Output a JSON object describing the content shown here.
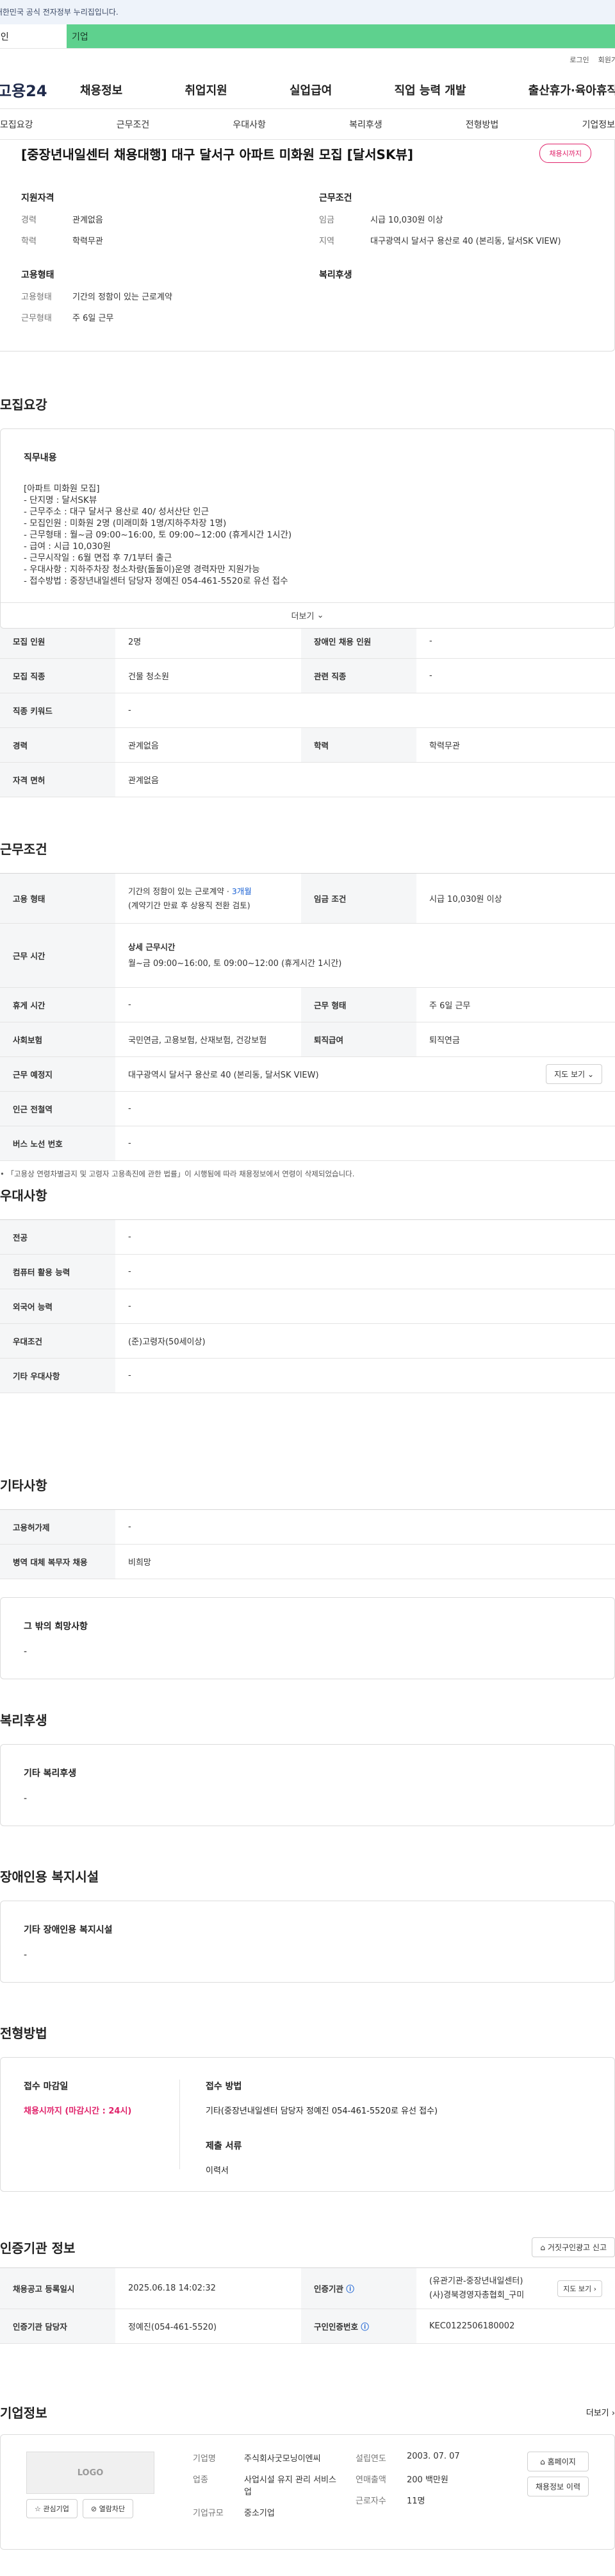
{
  "gov_notice": "이 누리집은 대한민국 공식 전자정부 누리집입니다.",
  "tabs": {
    "individual": "개인",
    "company": "기업"
  },
  "util": {
    "login": "로그인",
    "join": "회원가"
  },
  "brand": {
    "logo": "고용24"
  },
  "gnb": [
    "채용정보",
    "취업지원",
    "실업급여",
    "직업 능력 개발",
    "출산휴가·육아휴직"
  ],
  "subnav": [
    "모집요강",
    "근무조건",
    "우대사항",
    "복리후생",
    "전형방법",
    "기업정보"
  ],
  "summary": {
    "title": "[중장년내일센터 채용대행] 대구 달서구 아파트 미화원 모집 [달서SK뷰]",
    "badge": "채용시까지",
    "qual_title": "지원자격",
    "qual": [
      {
        "k": "경력",
        "v": "관계없음"
      },
      {
        "k": "학력",
        "v": "학력무관"
      }
    ],
    "cond_title": "근무조건",
    "cond": [
      {
        "k": "임금",
        "v": "시급 10,030원 이상"
      },
      {
        "k": "지역",
        "v": "대구광역시 달서구 용산로 40 (본리동, 달서SK VIEW)"
      }
    ],
    "emp_title": "고용형태",
    "emp": [
      {
        "k": "고용형태",
        "v": "기간의 정함이 있는 근로계약"
      },
      {
        "k": "근무형태",
        "v": "주 6일 근무"
      }
    ],
    "welfare_title": "복리후생"
  },
  "recruit": {
    "title": "모집요강",
    "duty_title": "직무내용",
    "duty_lines": [
      "[아파트 미화원 모집]",
      "- 단지명 : 달서SK뷰",
      "- 근무주소 : 대구 달서구 용산로 40/ 성서산단 인근",
      "- 모집인원 : 미화원 2명 (미래미화 1명/지하주차장 1명)",
      "- 근무형태 : 월~금 09:00~16:00, 토 09:00~12:00 (휴게시간 1시간)",
      "- 급여 : 시급 10,030원",
      "- 근무시작일 : 6월 면접 후 7/1부터 출근",
      "- 우대사항 : 지하주차장 청소차량(돌돌이)운영 경력자만 지원가능",
      "- 접수방법 : 중장년내일센터 담당자 정예진 054-461-5520로 유선 접수"
    ],
    "more": "더보기",
    "rows": [
      [
        "모집 인원",
        "2명",
        "장애인 채용 인원",
        "-"
      ],
      [
        "모집 직종",
        "건물 청소원",
        "관련 직종",
        "-"
      ],
      [
        "직종 키워드",
        "-"
      ],
      [
        "경력",
        "관계없음",
        "학력",
        "학력무관"
      ],
      [
        "자격 면허",
        "관계없음"
      ]
    ]
  },
  "work": {
    "title": "근무조건",
    "employment_label": "고용 형태",
    "employment_value": "기간의 정함이 있는 근로계약 ·",
    "employment_period": "3개월",
    "employment_sub": "(계약기간 만료 후 상용직 전환 검토)",
    "wage_label": "임금 조건",
    "wage_value": "시급 10,030원 이상",
    "hours_label": "근무 시간",
    "hours_head": "상세 근무시간",
    "hours_value": "월~금 09:00~16:00, 토 09:00~12:00 (휴게시간 1시간)",
    "break_label": "휴게 시간",
    "break_value": "-",
    "worktype_label": "근무 형태",
    "worktype_value": "주 6일 근무",
    "ins_label": "사회보험",
    "ins_value": "국민연금, 고용보험, 산재보험, 건강보험",
    "sev_label": "퇴직급여",
    "sev_value": "퇴직연금",
    "place_label": "근무 예정지",
    "place_value": "대구광역시 달서구 용산로 40 (본리동, 달서SK VIEW)",
    "map_btn": "지도 보기",
    "subway_label": "인근 전철역",
    "subway_value": "-",
    "bus_label": "버스 노선 번호",
    "bus_value": "-",
    "note": "「고용상 연령차별금지 및 고령자 고용촉진에 관한 법률」이 시행됨에 따라 채용정보에서 연령이 삭제되었습니다."
  },
  "pref": {
    "title": "우대사항",
    "rows": [
      [
        "전공",
        "-"
      ],
      [
        "컴퓨터 활용 능력",
        "-"
      ],
      [
        "외국어 능력",
        "-"
      ],
      [
        "우대조건",
        "(준)고령자(50세이상)"
      ],
      [
        "기타 우대사항",
        "-"
      ]
    ]
  },
  "etc": {
    "title": "기타사항",
    "rows": [
      [
        "고용허가제",
        "-"
      ],
      [
        "병역 대체 복무자 채용",
        "비희망"
      ]
    ],
    "other_title": "그 밖의 희망사항",
    "other_value": "-"
  },
  "welfare": {
    "title": "복리후생",
    "box_title": "기타 복리후생",
    "box_value": "-"
  },
  "disab": {
    "title": "장애인용 복지시설",
    "box_title": "기타 장애인용 복지시설",
    "box_value": "-"
  },
  "screening": {
    "title": "전형방법",
    "deadline_title": "접수 마감일",
    "deadline_value": "채용시까지 (마감시간 : 24시)",
    "method_title": "접수 방법",
    "method_value": "기타(중장년내일센터 담당자 정예진 054-461-5520로 유선 접수)",
    "docs_title": "제출 서류",
    "docs_value": "이력서"
  },
  "cert": {
    "title": "인증기관 정보",
    "report_btn": "거짓구인광고 신고",
    "reg_label": "채용공고 등록일시",
    "reg_value": "2025.06.18 14:02:32",
    "org_label": "인증기관",
    "org_value1": "(유관기관-중장년내일센터)",
    "org_value2": "(사)경북경영자총협회_구미",
    "map_btn": "지도 보기",
    "mgr_label": "인증기관 담당자",
    "mgr_value": "정예진(054-461-5520)",
    "no_label": "구인인증번호",
    "no_value": "KEC0122506180002"
  },
  "company": {
    "title": "기업정보",
    "more": "더보기",
    "logo_text": "LOGO",
    "fav_btn": "관심기업",
    "block_btn": "열람차단",
    "name_label": "기업명",
    "name_value": "주식회사굿모닝이엔씨",
    "ind_label": "업종",
    "ind_value": "사업시설 유지 관리 서비스업",
    "size_label": "기업규모",
    "size_value": "중소기업",
    "est_label": "설립연도",
    "est_value": "2003. 07. 07",
    "sales_label": "연매출액",
    "sales_value": "200 백만원",
    "emp_label": "근로자수",
    "emp_value": "11명",
    "home_btn": "홈페이지",
    "jobs_btn": "채용정보 이력"
  },
  "colors": {
    "tab_green": "#5ed18e",
    "accent_pink": "#e0226a",
    "link_blue": "#1b62d4"
  }
}
